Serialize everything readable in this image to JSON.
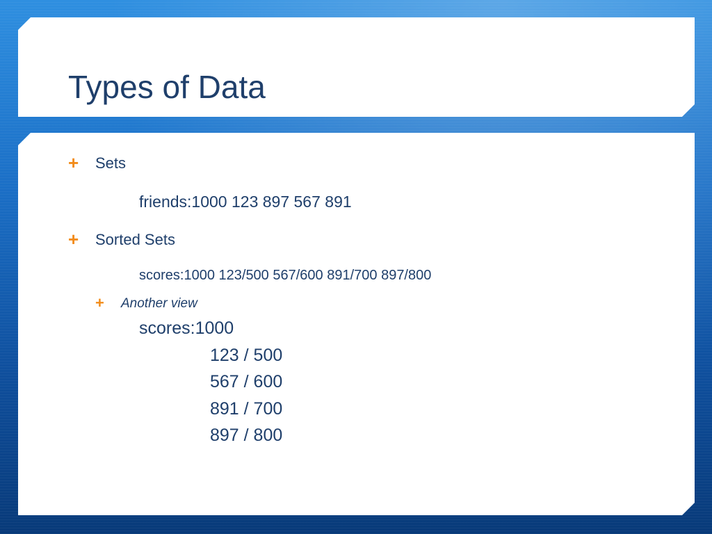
{
  "slide": {
    "title": "Types of Data",
    "bullets": [
      {
        "label": "Sets"
      },
      {
        "label": "Sorted Sets"
      }
    ],
    "sets_example": "friends:1000 123 897 567 891",
    "sorted_sets_example": "scores:1000 123/500  567/600  891/700  897/800",
    "sub_bullet": {
      "label": "Another view"
    },
    "another_view": {
      "key": "scores:1000",
      "entries": [
        "123 / 500",
        "567 / 600",
        "891 / 700",
        "897 / 800"
      ]
    },
    "colors": {
      "bullet": "#f28c1a",
      "text": "#1f3f6b",
      "background_top": "#2f8fe0",
      "background_bottom": "#083a79"
    }
  }
}
